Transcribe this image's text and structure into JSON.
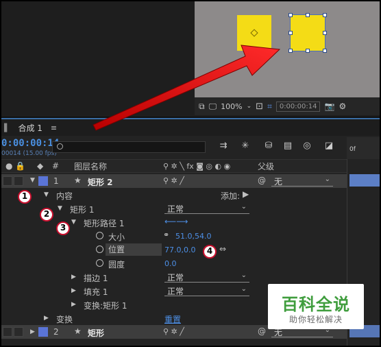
{
  "viewer": {
    "zoom": "100%",
    "timecode": "0:00:00:14"
  },
  "comp": {
    "tab_title": "合成 1",
    "menu_icon": "≡",
    "timecode": "0:00:00:14",
    "fps": "00014 (15.00 fps)",
    "ruler_label": "0f"
  },
  "columns": {
    "hash": "#",
    "layer_name": "图层名称",
    "parent": "父级"
  },
  "layers": [
    {
      "index": "1",
      "name": "矩形 2",
      "parent_value": "无"
    },
    {
      "index": "2",
      "name": "矩形",
      "parent_value": "无"
    }
  ],
  "props": {
    "contents": "内容",
    "add_label": "添加:",
    "rect_group": "矩形 1",
    "rect_group_blend": "正常",
    "rect_path": "矩形路径 1",
    "size": "大小",
    "size_value": "51.0,54.0",
    "position": "位置",
    "position_value": "77.0,0.0",
    "roundness": "圆度",
    "roundness_value": "0.0",
    "stroke": "描边 1",
    "stroke_mode": "正常",
    "fill": "填充 1",
    "fill_mode": "正常",
    "transform_rect": "变换:矩形 1",
    "transform": "变换",
    "reset": "重置"
  },
  "badges": [
    "1",
    "2",
    "3",
    "4"
  ],
  "watermark": {
    "title": "百科全说",
    "subtitle": "助你轻松解决"
  },
  "colors": {
    "shape_fill": "#f4dc16",
    "accent_blue": "#4d8fe6",
    "label_color": "#5a74d6",
    "arrow_red": "#e01a1a"
  }
}
